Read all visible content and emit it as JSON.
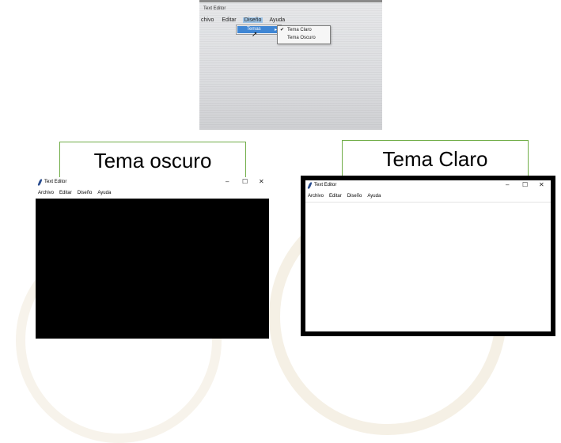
{
  "photo": {
    "window_title": "Text Editor",
    "menubar": [
      "chivo",
      "Editar",
      "Diseño",
      "Ayuda"
    ],
    "submenu_item": "Temas",
    "submenu_arrow": "▸",
    "flyout": [
      {
        "label": "Tema Claro",
        "checked": true
      },
      {
        "label": "Tema Oscuro",
        "checked": false
      }
    ],
    "check_glyph": "✔"
  },
  "captions": {
    "dark": "Tema oscuro",
    "light": "Tema Claro"
  },
  "windows": {
    "title": "Text Editor",
    "menu": [
      "Archivo",
      "Editar",
      "Diseño",
      "Ayuda"
    ],
    "controls": {
      "minimize": "–",
      "maximize": "☐",
      "close": "✕"
    }
  },
  "colors": {
    "dark_content": "#000000",
    "light_content": "#ffffff",
    "caption_border": "#70ad47",
    "menu_highlight": "#3f86d4"
  }
}
